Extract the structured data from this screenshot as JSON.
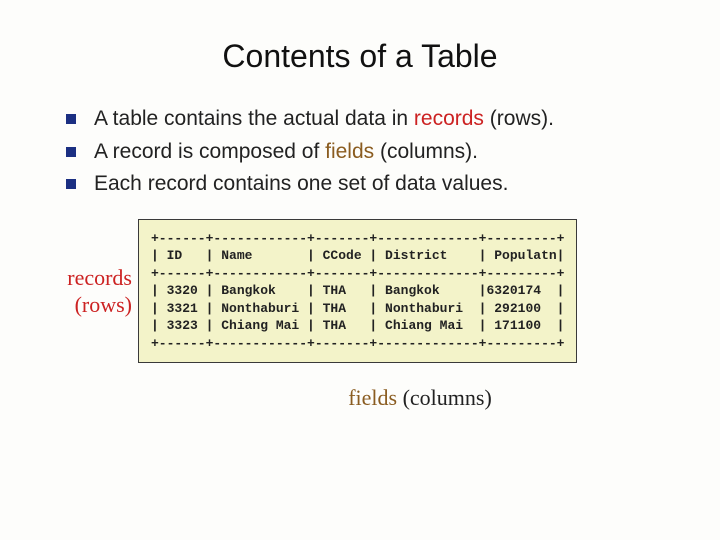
{
  "title": "Contents of a Table",
  "bullets": [
    {
      "pre": "A table contains the actual data in ",
      "kw": "records",
      "kwClass": "kw-red",
      "post": " (rows)."
    },
    {
      "pre": "A record is composed of ",
      "kw": "fields",
      "kwClass": "kw-brown",
      "post": " (columns)."
    },
    {
      "pre": "Each record contains one set of data values.",
      "kw": "",
      "kwClass": "",
      "post": ""
    }
  ],
  "row_label_line1": "records",
  "row_label_line2": "(rows)",
  "fields_label_kw": "fields",
  "fields_label_rest": " (columns)",
  "table": {
    "headers": [
      "ID",
      "Name",
      "CCode",
      "District",
      "Populatn"
    ],
    "rows": [
      [
        "3320",
        "Bangkok",
        "THA",
        "Bangkok",
        "6320174"
      ],
      [
        "3321",
        "Nonthaburi",
        "THA",
        "Nonthaburi",
        "292100"
      ],
      [
        "3323",
        "Chiang Mai",
        "THA",
        "Chiang Mai",
        "171100"
      ]
    ],
    "widths": [
      6,
      12,
      7,
      13,
      9
    ],
    "align": [
      "l",
      "l",
      "l",
      "l",
      "r"
    ]
  }
}
